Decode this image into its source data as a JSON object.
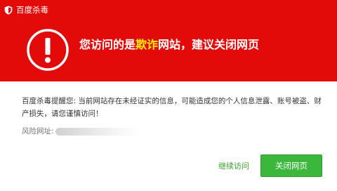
{
  "app": {
    "title": "百度杀毒"
  },
  "banner": {
    "headline_before": "您访问的是",
    "headline_highlight": "欺诈",
    "headline_after": "网站，建议关闭网页",
    "background_color": "#e30a0a",
    "highlight_color": "#fff200",
    "icon": "exclamation-circle-icon"
  },
  "body": {
    "message": "百度杀毒提醒您: 当前网站存在未经证实的信息，可能造成您的个人信息泄露、账号被盗、财产损失，请您谨慎访问！",
    "risk_label": "风险网址:"
  },
  "actions": {
    "continue_label": "继续访问",
    "close_label": "关闭网页",
    "continue_color": "#39a02a",
    "close_color": "#3bb83b"
  }
}
